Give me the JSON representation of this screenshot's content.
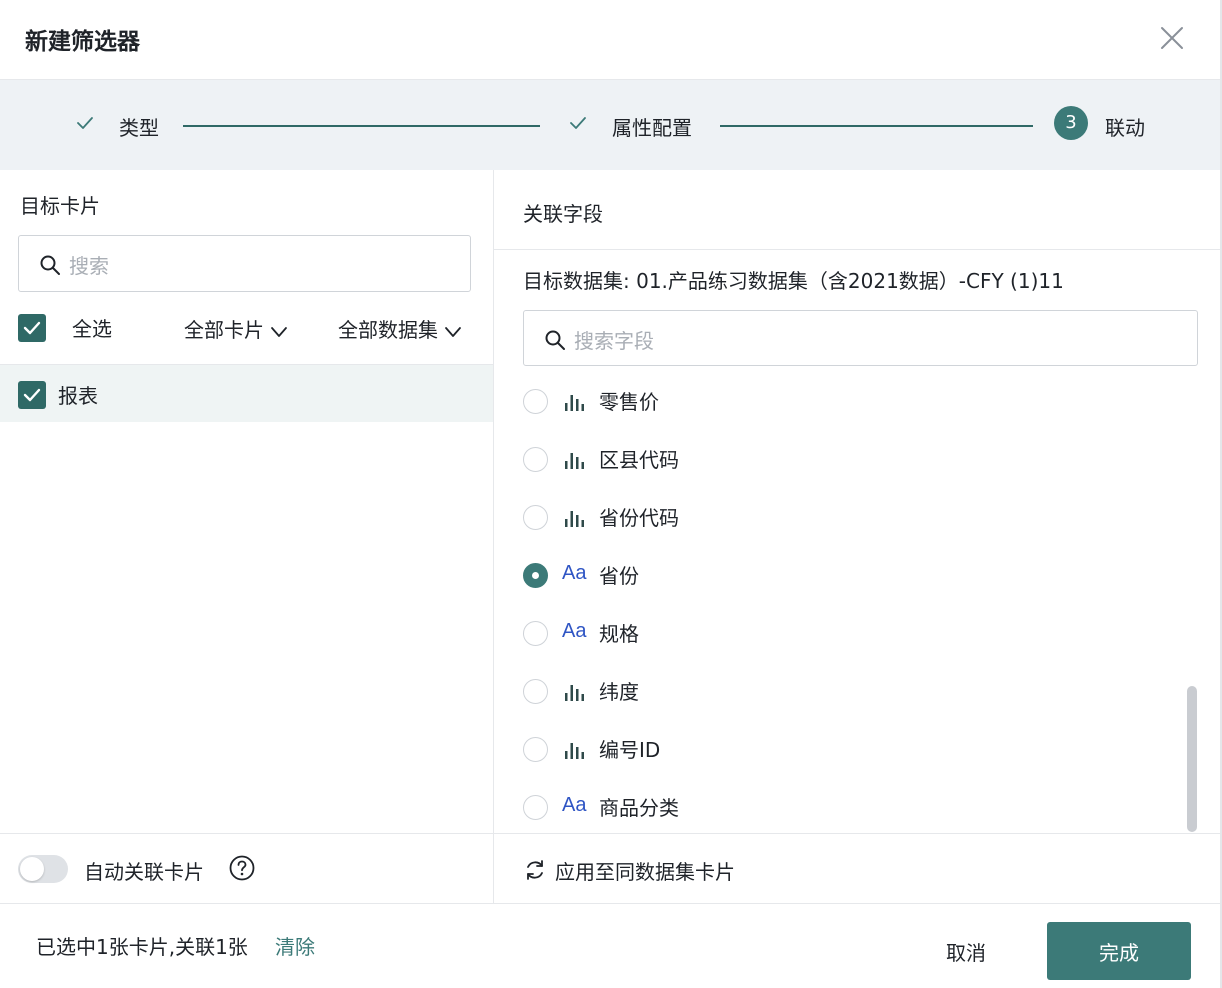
{
  "dialog": {
    "title": "新建筛选器",
    "close_icon": "close-icon"
  },
  "steps": [
    {
      "label": "类型",
      "state": "done"
    },
    {
      "label": "属性配置",
      "state": "done"
    },
    {
      "label": "联动",
      "state": "current",
      "number": "3"
    }
  ],
  "left_panel": {
    "title": "目标卡片",
    "search_placeholder": "搜索",
    "select_all_label": "全选",
    "filter_cards": "全部卡片",
    "filter_datasets": "全部数据集",
    "cards": [
      {
        "label": "报表",
        "checked": true
      }
    ],
    "auto_link_label": "自动关联卡片"
  },
  "right_panel": {
    "title": "关联字段",
    "dataset_label": "目标数据集: 01.产品练习数据集（含2021数据）-CFY (1)11",
    "search_placeholder": "搜索字段",
    "fields": [
      {
        "name": "零售价",
        "type": "measure",
        "selected": false
      },
      {
        "name": "区县代码",
        "type": "measure",
        "selected": false
      },
      {
        "name": "省份代码",
        "type": "measure",
        "selected": false
      },
      {
        "name": "省份",
        "type": "dimension",
        "type_text": "Aa",
        "selected": true
      },
      {
        "name": "规格",
        "type": "dimension",
        "type_text": "Aa",
        "selected": false
      },
      {
        "name": "纬度",
        "type": "measure",
        "selected": false
      },
      {
        "name": "编号ID",
        "type": "measure",
        "selected": false
      },
      {
        "name": "商品分类",
        "type": "dimension",
        "type_text": "Aa",
        "selected": false
      }
    ],
    "apply_label": "应用至同数据集卡片"
  },
  "footer": {
    "summary": "已选中1张卡片,关联1张",
    "clear_label": "清除",
    "cancel_label": "取消",
    "done_label": "完成"
  },
  "colors": {
    "accent": "#3c7a78",
    "step_line": "#2f6966",
    "step_bg": "#eef2f5",
    "row_highlight": "#eff4f4",
    "dimension_icon": "#2f55c4"
  }
}
